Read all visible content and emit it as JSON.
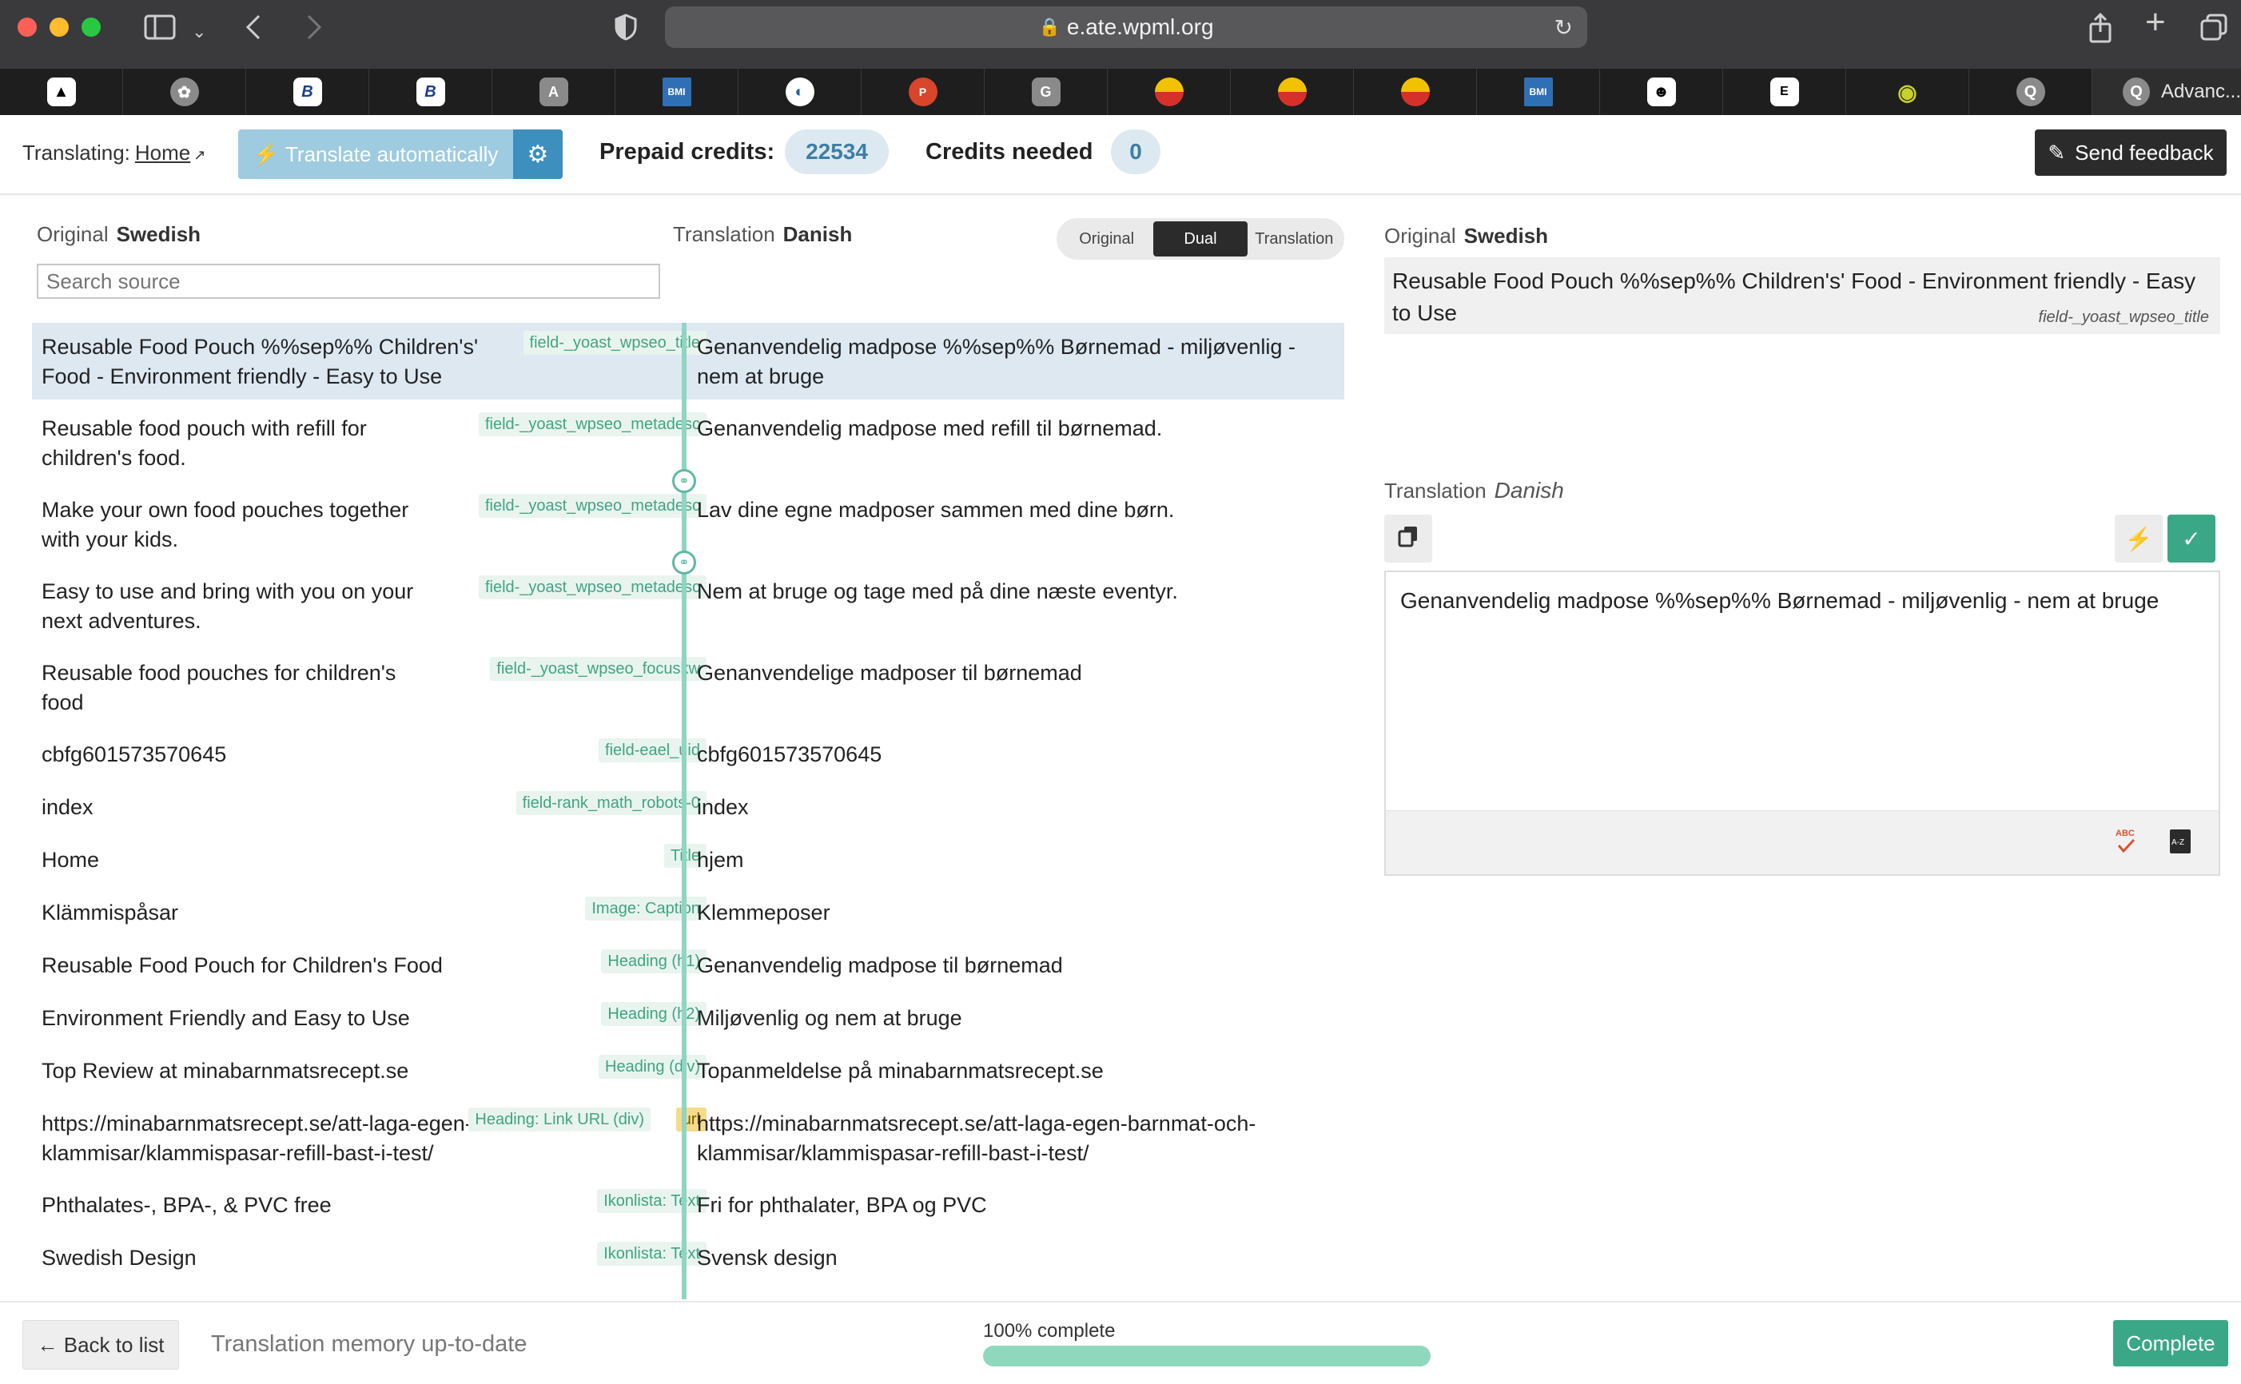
{
  "browser": {
    "url": "e.ate.wpml.org",
    "last_tab_label": "Advanc..."
  },
  "header": {
    "translating_label": "Translating:",
    "translating_link": "Home",
    "translate_auto_label": "Translate automatically",
    "prepaid_label": "Prepaid credits:",
    "prepaid_value": "22534",
    "needed_label": "Credits needed",
    "needed_value": "0",
    "feedback_label": "Send feedback"
  },
  "editor": {
    "original_label": "Original",
    "original_lang": "Swedish",
    "translation_label": "Translation",
    "translation_lang": "Danish",
    "view_modes": [
      "Original",
      "Dual",
      "Translation"
    ],
    "active_view": "Dual",
    "search_placeholder": "Search source",
    "rows": [
      {
        "source": "Reusable Food Pouch %%sep%% Children's' Food - Environment friendly - Easy to Use",
        "tag": "field-_yoast_wpseo_title",
        "target": "Genanvendelig madpose %%sep%% Børnemad - miljøvenlig - nem at bruge"
      },
      {
        "source": "Reusable food pouch with refill for children's food.",
        "tag": "field-_yoast_wpseo_metadesc",
        "target": "Genanvendelig madpose med refill til børnemad."
      },
      {
        "source": "Make your own food pouches together with your kids.",
        "tag": "field-_yoast_wpseo_metadesc",
        "target": "Lav dine egne madposer sammen med dine børn."
      },
      {
        "source": "Easy to use and bring with you on your next adventures.",
        "tag": "field-_yoast_wpseo_metadesc",
        "target": "Nem at bruge og tage med på dine næste eventyr."
      },
      {
        "source": "Reusable food pouches for children's food",
        "tag": "field-_yoast_wpseo_focuskw",
        "target": "Genanvendelige madposer til børnemad"
      },
      {
        "source": "cbfg601573570645",
        "tag": "field-eael_uid",
        "target": "cbfg601573570645"
      },
      {
        "source": "index",
        "tag": "field-rank_math_robots-0",
        "target": "index"
      },
      {
        "source": "Home",
        "tag": "Title",
        "target": "hjem"
      },
      {
        "source": "Klämmispåsar",
        "tag": "Image: Caption",
        "target": "Klemmeposer"
      },
      {
        "source": "Reusable Food Pouch for Children's Food",
        "tag": "Heading (h1)",
        "target": "Genanvendelig madpose til børnemad"
      },
      {
        "source": "Environment Friendly and Easy to Use",
        "tag": "Heading (h2)",
        "target": "Miljøvenlig og nem at bruge"
      },
      {
        "source": "Top Review at minabarnmatsrecept.se",
        "tag": "Heading (div)",
        "target": "Topanmeldelse på minabarnmatsrecept.se"
      },
      {
        "source": "https://minabarnmatsrecept.se/att-laga-egen-barnmat-och-klammisar/klammispasar-refill-bast-i-test/",
        "tag": "Heading: Link URL (div)",
        "extra_tag": "url",
        "target": "https://minabarnmatsrecept.se/att-laga-egen-barnmat-och-klammisar/klammispasar-refill-bast-i-test/"
      },
      {
        "source": "Phthalates-, BPA-, & PVC free",
        "tag": "Ikonlista: Text",
        "target": "Fri for phthalater, BPA og PVC"
      },
      {
        "source": "Swedish Design",
        "tag": "Ikonlista: Text",
        "target": "Svensk design"
      }
    ]
  },
  "side_panel": {
    "original_label": "Original",
    "original_lang": "Swedish",
    "original_text": "Reusable Food Pouch %%sep%% Children's' Food - Environment friendly - Easy to Use",
    "original_field": "field-_yoast_wpseo_title",
    "translation_label": "Translation",
    "translation_lang": "Danish",
    "translation_text": "Genanvendelig madpose %%sep%% Børnemad - miljøvenlig - nem at bruge",
    "spellcheck_badge": "ABC",
    "glossary_badge": "A-Z"
  },
  "footer": {
    "back_label": "← Back to list",
    "tm_status": "Translation memory up-to-date",
    "progress_label": "100% complete",
    "progress_fraction": 1.0,
    "complete_label": "Complete"
  },
  "colors": {
    "accent_blue": "#3d8fbd",
    "accent_green": "#3aa887",
    "divider_green": "#8fd4c4",
    "tag_green": "#3ea583",
    "selected_row": "#dde8f1"
  }
}
